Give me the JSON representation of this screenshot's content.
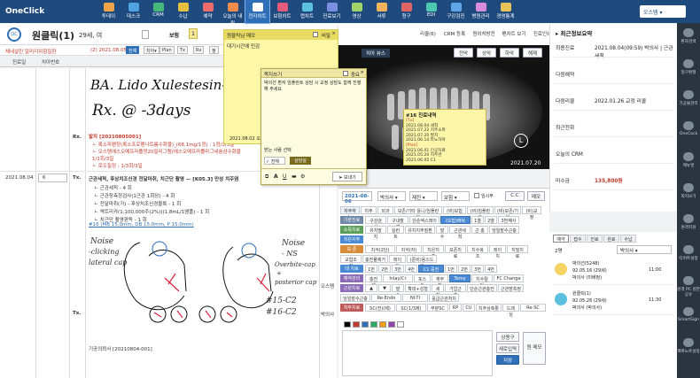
{
  "app": {
    "title": "OneClick",
    "user": "오스템"
  },
  "topnav": [
    {
      "label": "투데이"
    },
    {
      "label": "데스크"
    },
    {
      "label": "CRM"
    },
    {
      "label": "수납"
    },
    {
      "label": "예약"
    },
    {
      "label": "오늘의 내원"
    },
    {
      "label": "전자차트"
    },
    {
      "label": "보험차트"
    },
    {
      "label": "랩차트"
    },
    {
      "label": "진료보기"
    },
    {
      "label": "영상"
    },
    {
      "label": "서류"
    },
    {
      "label": "청구"
    },
    {
      "label": "EDI"
    },
    {
      "label": "구강검진"
    },
    {
      "label": "병원관리"
    },
    {
      "label": "경영통계"
    }
  ],
  "patient": {
    "name": "원클릭(1)",
    "age": "29세, 여",
    "insurance": "보험",
    "insurance_count": "1"
  },
  "alert": {
    "text": "체네살린 알러지위험질환",
    "date_label": "(2) 2021.08.05",
    "tabs": [
      "전체",
      "치아▾",
      "Plan",
      "Tx",
      "Rx",
      "정"
    ]
  },
  "chart_header": {
    "col1": "진료일",
    "col2": "치아번호"
  },
  "chart": {
    "handwriting1": "BA. Lido Xulestesin-A",
    "handwriting2": "Rx. @ -3days",
    "rx_label": "Rx.",
    "rx_title": "발치 [20210805001]",
    "rx_lines": [
      "ㄴ 록소피펜정(록소프로펜나트륨수화물)_(68.1mg/1정) : 1정/3/3일",
      "ㄴ 오스템에스오메프라졸정20밀리그램(에스오메프라졸마그네슘삼수화물",
      "1/1회/3일",
      "ㄴ 로도질정 : 1/3회/3일"
    ],
    "visit_date": "2021.08.04",
    "visit_tooth": "6",
    "tx_label": "Tx.",
    "tx_title": "근관세척, 후상치조신경 전달마취, 치근단 촬영 — [K05.3] 만성 치주염",
    "tx_lines": [
      "ㄴ 근관세척 - 4 회",
      "ㄴ 근관장측정검사(1근관 1회당) - 4 회",
      "ㄴ 전달마취(가) - 후상치조신경블록 - 1 회",
      "ㄴ 엑트리카(1:100,000주(2%))(1.8mL/1앰플) - 1 회",
      "ㄴ 치근단 촬영판독 - 1 회"
    ],
    "tx_link": "#16 (MB 15.0mm, DB 15.0mm, P 15.0mm)",
    "sketch_notes": [
      "Noise",
      "-clicking",
      "lateral cap",
      "Noise",
      "- NS",
      "Overbite-cap",
      "+",
      "posterior cap",
      "#15-C2",
      "#16-C2"
    ],
    "tx2_label": "Tx.",
    "footer_note": "기공의뢰서 [20210804-001]",
    "side_status1": "오스템",
    "side_status2": "박의사"
  },
  "sticky": {
    "title": "원클릭님 메모",
    "secret_label": "비밀",
    "body": "대기시간에 민감",
    "timestamp": "2021.08.02 오후 04:02"
  },
  "popup": {
    "title": "쪽지쓰기",
    "header_right": "중요",
    "body": "박의선 환자 임플란트 상담 시 교정 상담도 함께 진행해 주세요",
    "recipient_label": "받는 사람 선택",
    "check_all": "전체",
    "role": "상담실",
    "send_label": "보내기"
  },
  "xray": {
    "top_right_buttons": [
      "리콜(6)",
      "CRM 등록",
      "원외처방전",
      "펜차트 보기",
      "진료인쇄",
      "기공의뢰서"
    ],
    "viewer_buttons": [
      "전악",
      "상악",
      "하악",
      "해제"
    ],
    "label_left": "치아 뷰스",
    "overlay": {
      "title": "#16 진료내역",
      "lines": [
        "[Tx]",
        "2021.08.04 세척",
        "2021.07.22 치주소파",
        "2021.07.20 발치",
        "2021.06.14 파노하마",
        "[Plan]",
        "2021.06.01 인공치료",
        "2021.05.20 치주관",
        "",
        "2021.06.05 C1"
      ]
    },
    "letter_l": "L",
    "date": "2021.07.20"
  },
  "rx": {
    "date": "2021-08-06",
    "doctor_select": "박의사",
    "staff_select": "제진",
    "insurance_select": "보험",
    "temp_label": "임시부",
    "btn_cc": "C.C",
    "btn_memo": "메모",
    "section_tabs": [
      "자주하는",
      "치주",
      "외과",
      "보존/기타 틀니/임플란트",
      "(비)보험",
      "(비)임플란트",
      "(비)보존/기타",
      "(비)교정"
    ],
    "rows": [
      {
        "label": "기본진료",
        "items": [
          "구강검사",
          "구내촬영",
          "단순엑스레이",
          "(보험)매복",
          "1열",
          "2열",
          "3번째사"
        ]
      },
      {
        "label": "소목치료",
        "items": [
          "유치발치",
          "실런트",
          "유치치주질환",
          "발수",
          "근관세척",
          "근 충",
          "당일발수근충"
        ]
      },
      {
        "label": "치은지주",
        "items": []
      },
      {
        "label": "보 존",
        "items": [
          "치석(2단)",
          "치석(자)",
          "치은치주",
          "보존치료",
          "치수복조",
          "레이치",
          "치밀치료"
        ]
      },
      {
        "label": "",
        "items": [
          "교합조정",
          "충전물제거",
          "레이어",
          "(준비)용스드로"
        ]
      },
      {
        "label": "대 치료",
        "items": [
          "1번",
          "2번",
          "3번",
          "4번",
          "C1 중전",
          "1번",
          "2번",
          "3번",
          "4번"
        ]
      },
      {
        "label": "예약관리카",
        "items": [
          "충전제",
          "Inlay/Cr",
          "포스트",
          "재부착",
          "Tomy",
          "치수절단",
          "FC Change"
        ]
      },
      {
        "label": "근관치료",
        "items": [
          "▲",
          "▼",
          "발수",
          "확대+성형",
          "세척",
          "가압근충",
          "단순근관충전",
          "근관장측정"
        ]
      },
      {
        "label": "",
        "items": [
          "당일발수근충",
          "Re-Endo",
          "NI-TI",
          "응급근관처치"
        ]
      },
      {
        "label": "치주치료",
        "items": [
          "SC(전)(제)",
          "SC(1/3제)",
          "부분SC",
          "RP",
          "CU",
          "치주상축활",
          "드레싱",
          "Re-SC"
        ]
      }
    ],
    "consult_btn": "상용구",
    "new_input_btn": "새로입력",
    "save_btn": "저장",
    "new_memo_btn": "원 메모"
  },
  "summary": {
    "title": "최근정보요약",
    "items": [
      {
        "label": "최종진료",
        "value": "2021.08.04(09:59) 박의사 | 근관세척..."
      },
      {
        "label": "다음예약",
        "value": ""
      },
      {
        "label": "다음리콜",
        "value": "2022.01.26 교정 리콜"
      },
      {
        "label": "최근전화",
        "value": ""
      },
      {
        "label": "오늘의 CRM",
        "value": ""
      },
      {
        "label": "미수금",
        "value": "135,800원"
      }
    ]
  },
  "appt": {
    "tabs": [
      "예약",
      "접수",
      "진료",
      "완료",
      "수납"
    ],
    "count_label": "2명",
    "doctor_select": "박의사",
    "items": [
      {
        "name": "박의선(5248)",
        "dob": "92.05.16 (29세)",
        "doctor": "박의사 (미배정)",
        "time": "11:00"
      },
      {
        "name": "원클릭(1)",
        "dob": "92.05.26 (29세)",
        "doctor": "박의사 (박의사)",
        "time": "11:30"
      }
    ]
  },
  "rightnav": [
    {
      "label": "환자검색"
    },
    {
      "label": "정구환행"
    },
    {
      "label": "기공물관리"
    },
    {
      "label": "OneCock"
    },
    {
      "label": "메뉴얼"
    },
    {
      "label": "쪽지보기"
    },
    {
      "label": "원격지원"
    },
    {
      "label": "티머트설정"
    },
    {
      "label": "원격 PC 원한 공유"
    },
    {
      "label": "SmartSign"
    },
    {
      "label": "팩폭노트설정"
    }
  ],
  "colors": {
    "topbar": "#1e4a7e",
    "accent": "#2f6fb8",
    "sticky": "#fdf7a8",
    "rightnav": "#2b3540",
    "red": "#c0392b"
  }
}
